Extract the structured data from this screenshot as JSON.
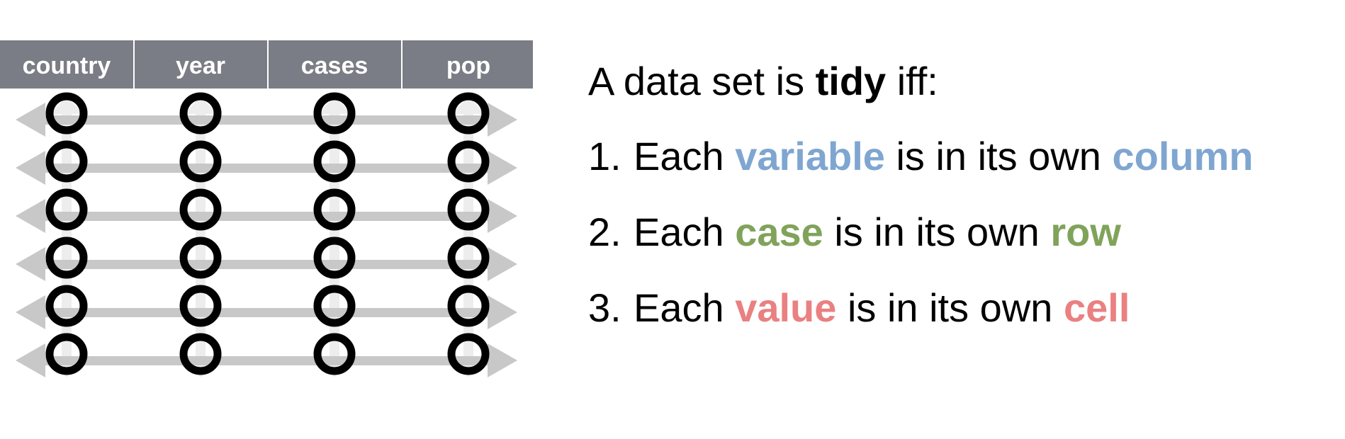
{
  "table": {
    "columns": [
      "country",
      "year",
      "cases",
      "pop"
    ],
    "row_count": 6,
    "colors": {
      "header_background": "#7a7d85",
      "header_text": "#ffffff",
      "header_divider": "#ffffff",
      "cell_marker": "#000000",
      "row_arrow": "#c8c8c8",
      "column_arrow": "#ededed"
    }
  },
  "headline": {
    "prefix": "A data set is ",
    "emphasis": "tidy",
    "suffix": " iff:"
  },
  "rules": [
    {
      "number": "1.",
      "lead": "Each ",
      "keyword1": "variable",
      "middle": " is in its own ",
      "keyword2": "column",
      "color": "#7fa6d0"
    },
    {
      "number": "2.",
      "lead": "Each ",
      "keyword1": "case",
      "middle": " is in its own ",
      "keyword2": "row",
      "color": "#80a35a"
    },
    {
      "number": "3.",
      "lead": "Each ",
      "keyword1": "value",
      "middle": " is in its own ",
      "keyword2": "cell",
      "color": "#ea8080"
    }
  ]
}
